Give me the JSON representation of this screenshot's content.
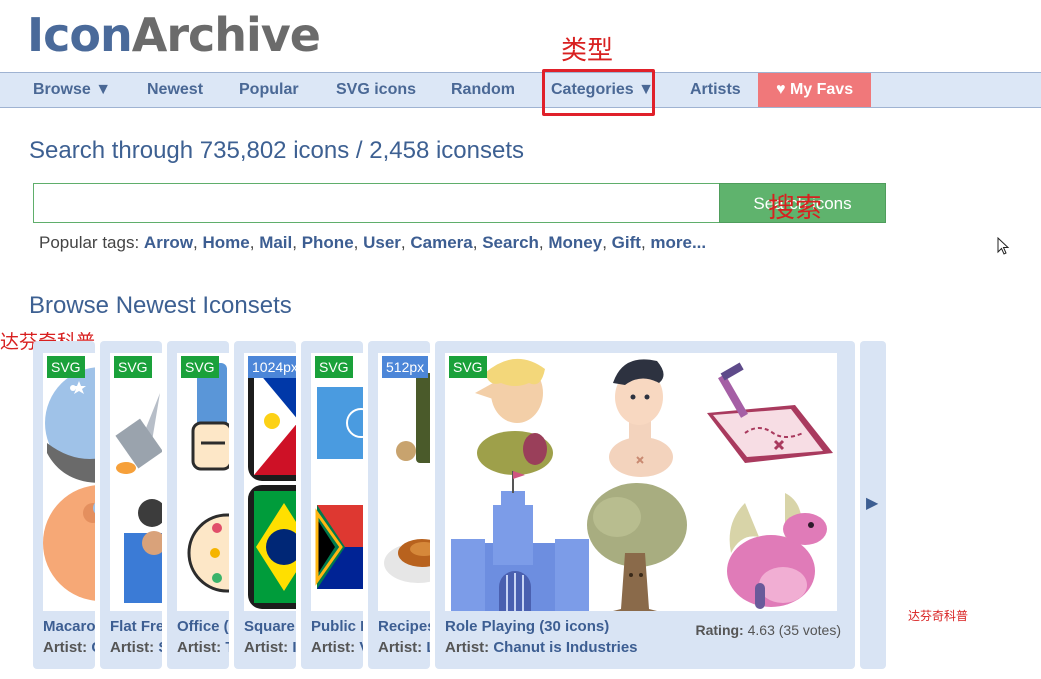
{
  "logo": {
    "part1": "Icon",
    "part2": "Archive"
  },
  "nav": {
    "browse": "Browse ▼",
    "newest": "Newest",
    "popular": "Popular",
    "svg_icons": "SVG icons",
    "random": "Random",
    "categories": "Categories ▼",
    "artists": "Artists",
    "my_favs": "♥ My Favs"
  },
  "annotations": {
    "leixing": "类型",
    "sousuo": "搜索",
    "watermark1": "达芬奇科普",
    "watermark2": "达芬奇科普"
  },
  "search": {
    "heading": "Search through 735,802 icons / 2,458 iconsets",
    "placeholder": "",
    "button": "Search icons"
  },
  "tags": {
    "label": "Popular tags:",
    "items": [
      "Arrow",
      "Home",
      "Mail",
      "Phone",
      "User",
      "Camera",
      "Search",
      "Money",
      "Gift",
      "more..."
    ]
  },
  "newest": {
    "heading": "Browse Newest Iconsets"
  },
  "cards": [
    {
      "badge": "SVG",
      "title": "Macaro",
      "artist_label": "Artist:",
      "artist": "C"
    },
    {
      "badge": "SVG",
      "title": "Flat Fre",
      "artist_label": "Artist:",
      "artist": "S"
    },
    {
      "badge": "SVG",
      "title": "Office (",
      "artist_label": "Artist:",
      "artist": "T"
    },
    {
      "badge": "1024px",
      "title": "Square",
      "artist_label": "Artist:",
      "artist": "I"
    },
    {
      "badge": "SVG",
      "title": "Public I",
      "artist_label": "Artist:",
      "artist": "V"
    },
    {
      "badge": "512px",
      "title": "Recipes",
      "artist_label": "Artist:",
      "artist": "L"
    },
    {
      "badge": "SVG",
      "title": "Role Playing (30 icons)",
      "artist_label": "Artist:",
      "artist": "Chanut is Industries",
      "rating_label": "Rating:",
      "rating": "4.63 (35 votes)"
    }
  ],
  "colors": {
    "brand_blue": "#4a6a9a",
    "nav_bg": "#dce7f6",
    "favs": "#f0787a",
    "search_green": "#5fb36d",
    "svg_badge": "#1aa13a",
    "px_badge": "#4c86d8",
    "annotation_red": "#e0202a"
  }
}
